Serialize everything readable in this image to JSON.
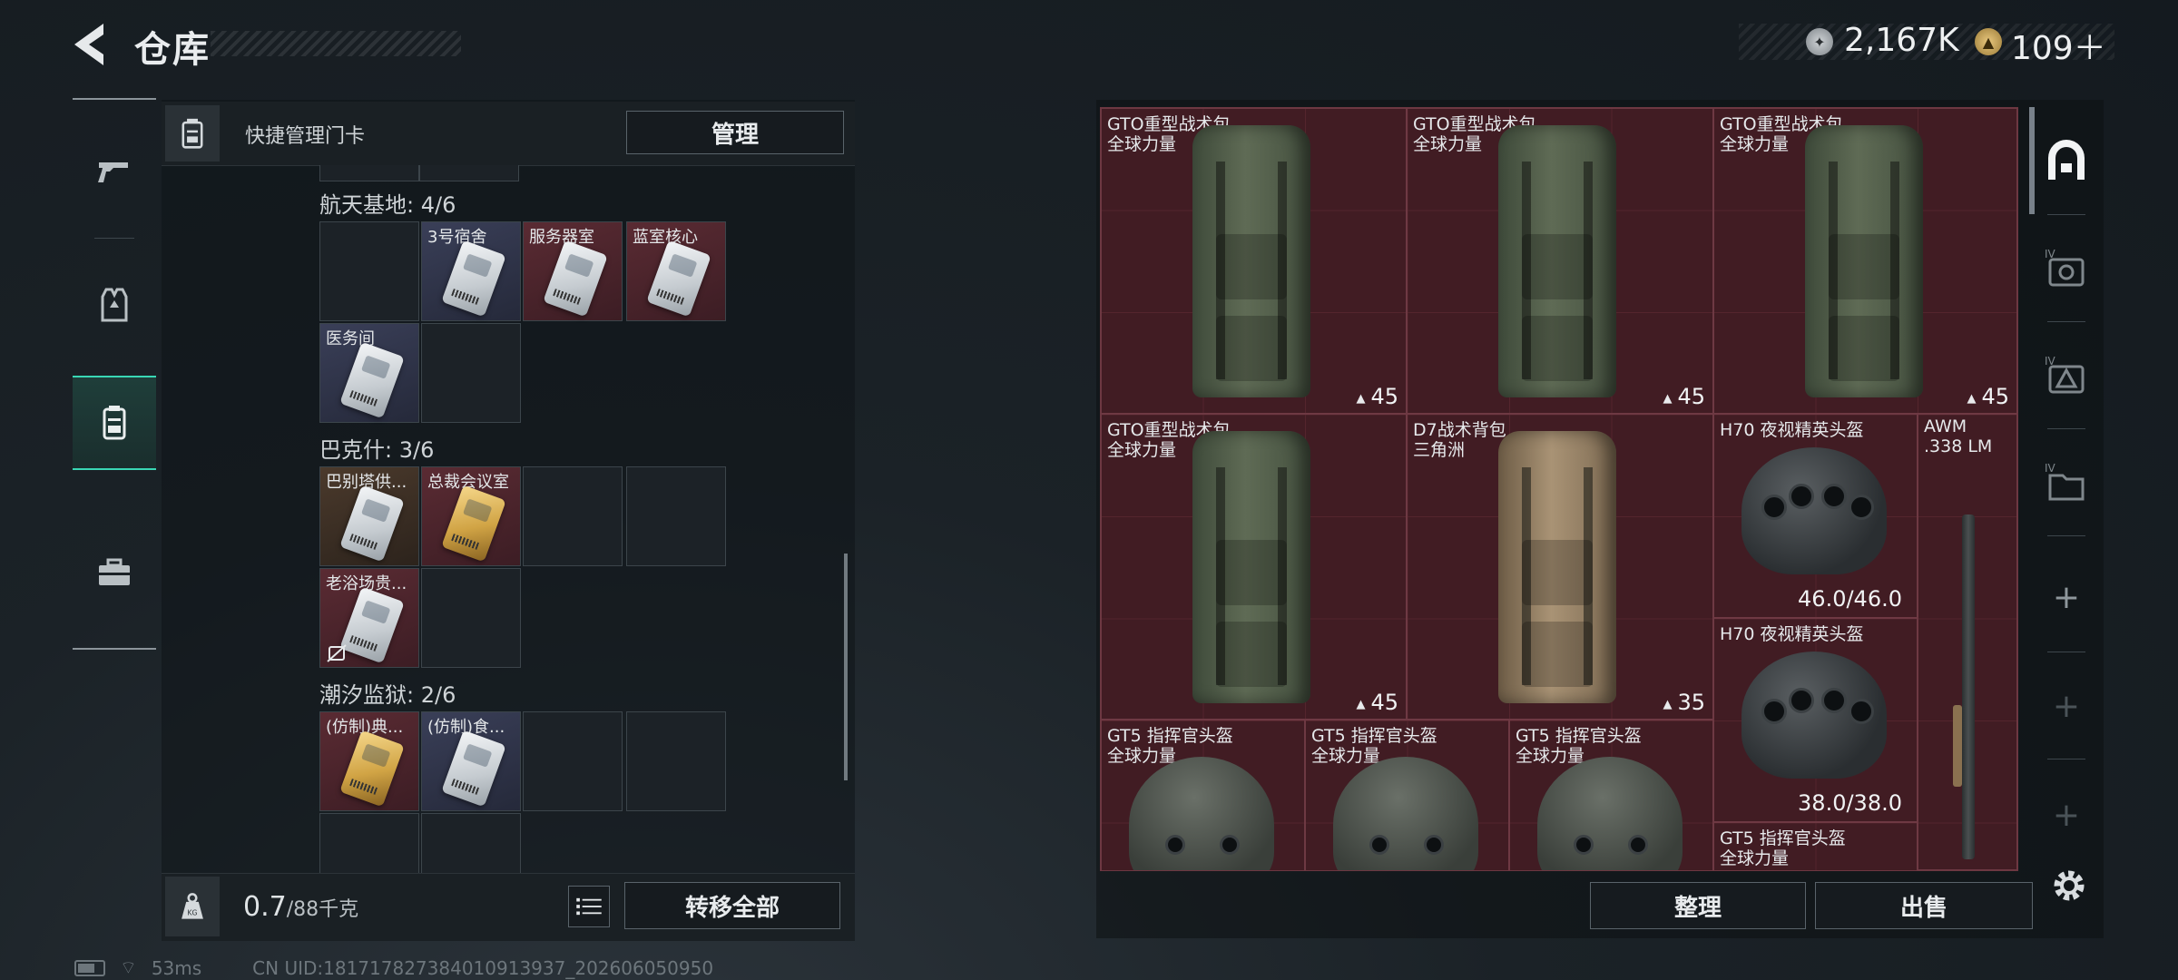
{
  "header": {
    "title": "仓库"
  },
  "currency": {
    "silver": "2,167K",
    "gold": "109＋",
    "gold_icon": "gold-coin-icon",
    "silver_icon": "silver-coin-icon"
  },
  "left_rail": [
    "weapons-tab",
    "armor-tab",
    "keycard-tab",
    "toolbox-tab"
  ],
  "key_panel": {
    "header_label": "快捷管理门卡",
    "manage_label": "管理",
    "sections": [
      {
        "title": "航天基地: 4/6",
        "cards": [
          "3号宿舍",
          "服务器室",
          "蓝室核心",
          "医务间"
        ]
      },
      {
        "title": "巴克什: 3/6",
        "cards": [
          "巴别塔供...",
          "总裁会议室",
          "老浴场贵..."
        ]
      },
      {
        "title": "潮汐监狱: 2/6",
        "cards": [
          "(仿制)典...",
          "(仿制)食..."
        ]
      }
    ],
    "weight_value": "0.7",
    "weight_max": "/88千克",
    "transfer_label": "转移全部"
  },
  "stash": {
    "items": [
      {
        "name": "GTO重型战术包",
        "sub": "全球力量",
        "capacity": "45"
      },
      {
        "name": "GTO重型战术包",
        "sub": "全球力量",
        "capacity": "45"
      },
      {
        "name": "GTO重型战术包",
        "sub": "全球力量",
        "capacity": "45"
      },
      {
        "name": "GTO重型战术包",
        "sub": "全球力量",
        "capacity": "45"
      },
      {
        "name": "D7战术背包",
        "sub": "三角洲",
        "capacity": "35"
      },
      {
        "name": "H70 夜视精英头盔",
        "durability": "46.0/46.0"
      },
      {
        "name": "AWM",
        "sub": ".338 LM"
      },
      {
        "name": "H70 夜视精英头盔",
        "durability": "38.0/38.0"
      },
      {
        "name": "GT5 指挥官头盔",
        "sub": "全球力量"
      },
      {
        "name": "GT5 指挥官头盔",
        "sub": "全球力量"
      },
      {
        "name": "GT5 指挥官头盔",
        "sub": "全球力量"
      },
      {
        "name": "GT5 指挥官头盔",
        "sub": "全球力量"
      }
    ],
    "sort_label": "整理",
    "sell_label": "出售"
  },
  "status_bar": {
    "ping": "53ms",
    "uid": "CN UID:181717827384010913937_202606050950"
  }
}
